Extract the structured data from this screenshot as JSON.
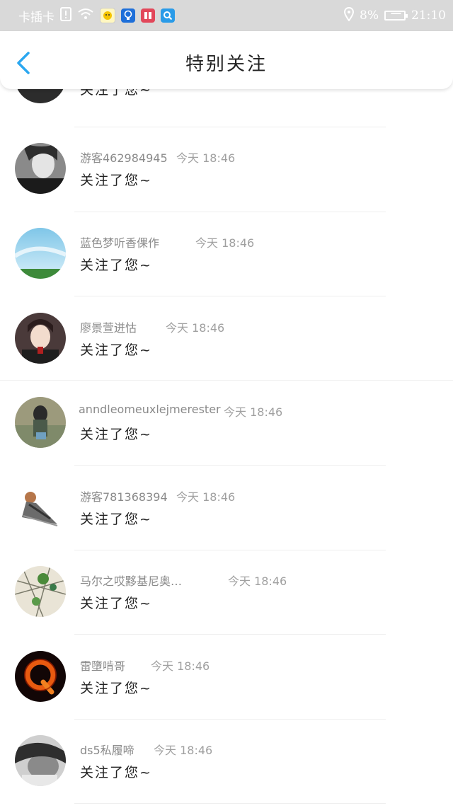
{
  "status_bar": {
    "carrier": "卡插卡",
    "battery_percent": "8%",
    "time": "21:10"
  },
  "header": {
    "title": "特别关注"
  },
  "items": [
    {
      "name": "",
      "time": "",
      "message": "关注了您~"
    },
    {
      "name": "游客462984945",
      "time": "今天 18:46",
      "message": "关注了您~"
    },
    {
      "name": "蓝色梦听香倮作",
      "time": "今天 18:46",
      "message": "关注了您~"
    },
    {
      "name": "廖景萱迸怙",
      "time": "今天 18:46",
      "message": "关注了您~"
    },
    {
      "name": "anndleomeuxlejmerester",
      "time": "今天 18:46",
      "message": "关注了您~"
    },
    {
      "name": "游客781368394",
      "time": "今天 18:46",
      "message": "关注了您~"
    },
    {
      "name": "马尔之哎黟基尼奥…",
      "time": "今天 18:46",
      "message": "关注了您~"
    },
    {
      "name": "雷墮啃哥",
      "time": "今天 18:46",
      "message": "关注了您~"
    },
    {
      "name": "ds5私履啼",
      "time": "今天 18:46",
      "message": "关注了您~"
    }
  ]
}
